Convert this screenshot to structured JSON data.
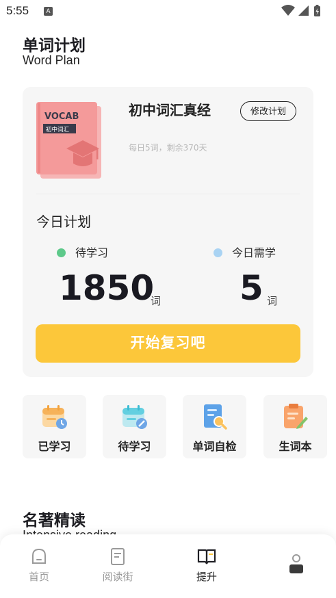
{
  "status_bar": {
    "time": "5:55",
    "app_icon_letter": "A"
  },
  "header": {
    "title": "单词计划",
    "subtitle": "Word Plan"
  },
  "plan_card": {
    "book_cover": {
      "brand": "VOCAB",
      "tag": "初中词汇",
      "color": "#f49a9a",
      "tag_color": "#3a3a4a"
    },
    "book_title": "初中词汇真经",
    "edit_button": "修改计划",
    "meta": "每日5词，剩余370天",
    "today_title": "今日计划",
    "pending": {
      "label": "待学习",
      "value": "1850",
      "unit": "词",
      "dot_color": "#5dc98a"
    },
    "needed": {
      "label": "今日需学",
      "value": "5",
      "unit": "词",
      "dot_color": "#a9d3f3"
    },
    "review_button": "开始复习吧",
    "review_button_color": "#fcc73a"
  },
  "tiles": [
    {
      "label": "已学习",
      "icon": "calendar-clock-icon"
    },
    {
      "label": "待学习",
      "icon": "calendar-edit-icon"
    },
    {
      "label": "单词自检",
      "icon": "document-search-icon"
    },
    {
      "label": "生词本",
      "icon": "clipboard-pencil-icon"
    }
  ],
  "reading": {
    "title": "名著精读",
    "subtitle": "Intensive reading"
  },
  "bottom_nav": {
    "items": [
      {
        "label": "首页",
        "icon": "home-icon",
        "active": false
      },
      {
        "label": "阅读街",
        "icon": "book-icon",
        "active": false
      },
      {
        "label": "提升",
        "icon": "open-book-icon",
        "active": true
      },
      {
        "label": "",
        "icon": "profile-icon",
        "active": false
      }
    ]
  }
}
